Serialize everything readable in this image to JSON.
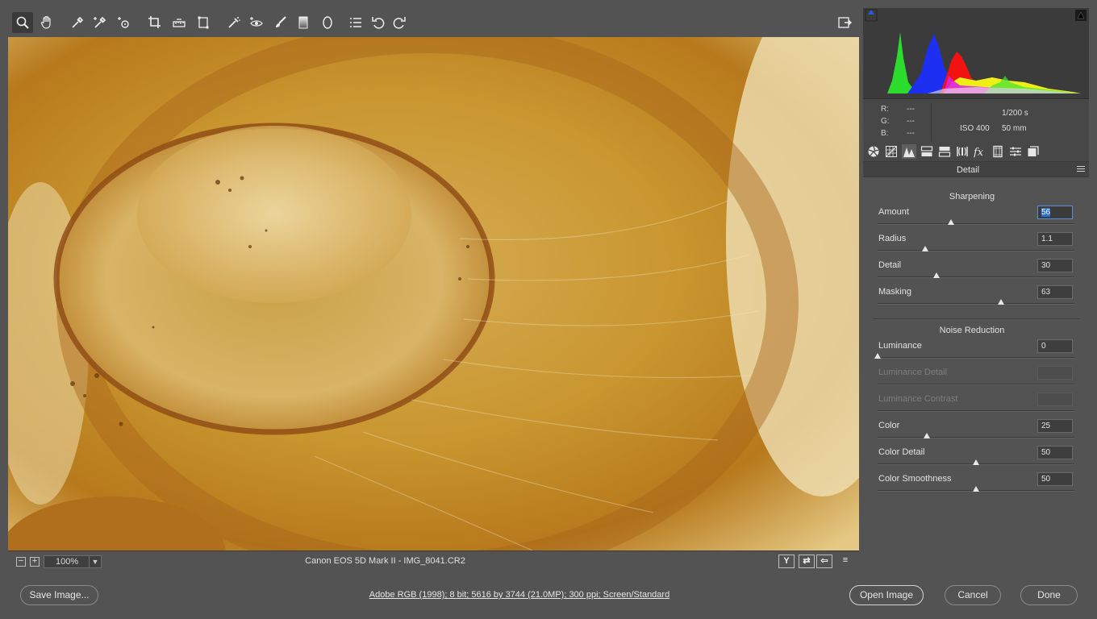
{
  "toolbar": {
    "tools": [
      "zoom-tool",
      "hand-tool",
      "white-balance-tool",
      "color-sampler-tool",
      "targeted-adjustment-tool",
      "crop-tool",
      "straighten-tool",
      "transform-tool",
      "spot-removal-tool",
      "red-eye-removal-tool",
      "adjustment-brush-tool",
      "graduated-filter-tool",
      "radial-filter-tool",
      "open-preferences",
      "rotate-left-tool",
      "rotate-right-tool",
      "fullscreen-toggle"
    ]
  },
  "image_status": {
    "zoom_minus": "−",
    "zoom_plus": "+",
    "zoom_value": "100%",
    "filename": "Canon EOS 5D Mark II  -  IMG_8041.CR2",
    "view_buttons": [
      "Y",
      "⇄",
      "⇦",
      "≡"
    ]
  },
  "info": {
    "r_label": "R:",
    "r_value": "---",
    "g_label": "G:",
    "g_value": "---",
    "b_label": "B:",
    "b_value": "---",
    "shutter": "1/200 s",
    "iso": "ISO 400",
    "focal": "50 mm"
  },
  "panel": {
    "title": "Detail",
    "sharpening": {
      "title": "Sharpening",
      "amount_label": "Amount",
      "amount_value": "56",
      "amount_frac": 0.374,
      "radius_label": "Radius",
      "radius_value": "1.1",
      "radius_frac": 0.24,
      "detail_label": "Detail",
      "detail_value": "30",
      "detail_frac": 0.3,
      "masking_label": "Masking",
      "masking_value": "63",
      "masking_frac": 0.626
    },
    "noise": {
      "title": "Noise Reduction",
      "luminance_label": "Luminance",
      "luminance_value": "0",
      "luminance_frac": 0.0,
      "lum_detail_label": "Luminance Detail",
      "lum_contrast_label": "Luminance Contrast",
      "color_label": "Color",
      "color_value": "25",
      "color_frac": 0.25,
      "color_detail_label": "Color Detail",
      "color_detail_value": "50",
      "color_detail_frac": 0.5,
      "color_smooth_label": "Color Smoothness",
      "color_smooth_value": "50",
      "color_smooth_frac": 0.5
    }
  },
  "footer": {
    "save_label": "Save Image...",
    "info_link": "Adobe RGB (1998); 8 bit; 5616 by 3744 (21.0MP); 300 ppi; Screen/Standard",
    "open_label": "Open Image",
    "cancel_label": "Cancel",
    "done_label": "Done"
  }
}
